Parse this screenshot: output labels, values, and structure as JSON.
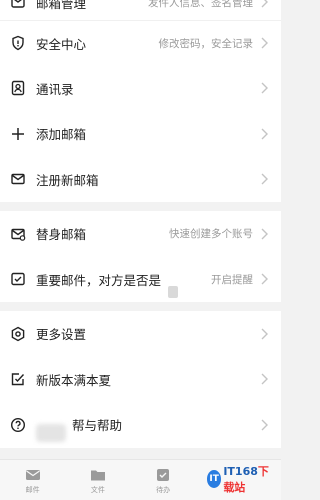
{
  "groups": [
    {
      "items": [
        {
          "label": "邮箱管理",
          "hint": "发件人信息、签名管理"
        },
        {
          "label": "安全中心",
          "hint": "修改密码，安全记录"
        },
        {
          "label": "通讯录",
          "hint": ""
        },
        {
          "label": "添加邮箱",
          "hint": ""
        },
        {
          "label": "注册新邮箱",
          "hint": ""
        }
      ]
    },
    {
      "items": [
        {
          "label": "替身邮箱",
          "hint": "快速创建多个账号"
        },
        {
          "label": "重要邮件，对方是否是",
          "hint": "开启提醒"
        }
      ]
    },
    {
      "items": [
        {
          "label": "更多设置",
          "hint": ""
        },
        {
          "label": "新版本满本夏",
          "hint": ""
        },
        {
          "label": "帮与帮助",
          "hint": ""
        }
      ]
    }
  ],
  "tabbar": {
    "tabs": [
      {
        "label": "邮件",
        "icon": "mail-icon"
      },
      {
        "label": "文件",
        "icon": "folder-icon"
      },
      {
        "label": "待办",
        "icon": "todo-icon"
      }
    ]
  },
  "watermark": {
    "logo": "IT",
    "text_a": "IT168",
    "text_b": "下载站"
  },
  "colors": {
    "accent": "#2a7de1",
    "hint": "#9a9a9a",
    "background": "#f2f2f2"
  }
}
